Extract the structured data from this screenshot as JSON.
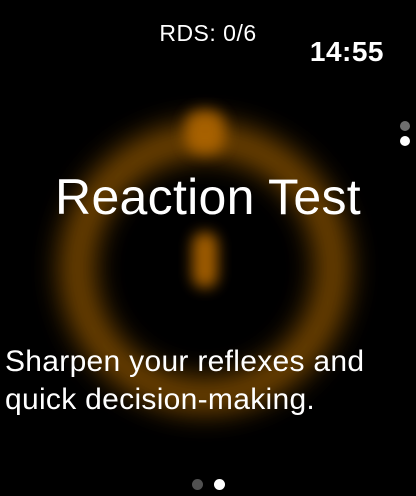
{
  "status": {
    "rounds": "RDS: 0/6",
    "time": "14:55"
  },
  "vertical_pager": {
    "count": 2,
    "active_index": 1
  },
  "main": {
    "title": "Reaction Test",
    "subtitle": "Sharpen your reflexes and quick decision-making.",
    "background_icon": "stopwatch-icon"
  },
  "page_indicator": {
    "count": 2,
    "active_index": 1
  },
  "colors": {
    "background": "#000000",
    "accent_glow": "#b36a00",
    "text": "#ffffff",
    "dot_inactive": "#505050",
    "dot_active": "#ffffff"
  }
}
